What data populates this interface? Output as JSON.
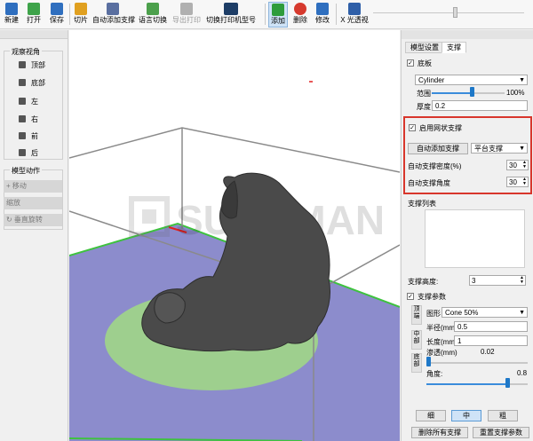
{
  "toolbar": {
    "buttons": [
      {
        "label": "新建",
        "icon": "new-file-icon",
        "color": "#2f6fbf"
      },
      {
        "label": "打开",
        "icon": "open-icon",
        "color": "#3ea34a"
      },
      {
        "label": "保存",
        "icon": "save-icon",
        "color": "#2f6fbf"
      },
      {
        "label": "切片",
        "icon": "slice-icon",
        "color": "#e0a020"
      },
      {
        "label": "自动添加支撑",
        "icon": "auto-support-icon",
        "color": "#5a6fa0"
      },
      {
        "label": "语言切换",
        "icon": "language-icon",
        "color": "#4ca04c"
      },
      {
        "label": "导出打印",
        "icon": "export-print-icon",
        "color": "#b0b0b0"
      },
      {
        "label": "切换打印机型号",
        "icon": "printer-model-icon",
        "color": "#1d3d66"
      },
      {
        "label": "添加",
        "icon": "add-icon",
        "color": "#2e9c3c"
      },
      {
        "label": "删除",
        "icon": "delete-icon",
        "color": "#d63a2e"
      },
      {
        "label": "修改",
        "icon": "edit-icon",
        "color": "#2f6fbf"
      },
      {
        "label": "X 光透视",
        "icon": "xray-icon",
        "color": "#2f5fa8"
      }
    ]
  },
  "left_panel": {
    "view_group_title": "观察视角",
    "views": [
      "顶部",
      "底部",
      "左",
      "右",
      "前",
      "后"
    ],
    "action_group_title": "模型动作",
    "actions": [
      "+ 移动",
      "缩放",
      "↻ 垂直旋转"
    ]
  },
  "viewport": {
    "watermark": "SUNDMAN"
  },
  "right_panel": {
    "tabs": [
      "模型设置",
      "支撑"
    ],
    "base": {
      "label": "底板",
      "checked": true,
      "shape": "Cylinder",
      "range_label": "范围",
      "range_value": "100%",
      "range_fraction": 0.55,
      "thickness_label": "厚度",
      "thickness_value": "0.2"
    },
    "mesh_support": {
      "label": "启用网状支撑",
      "checked": true,
      "auto_add_button": "自动添加支撑",
      "platform_select": "平台支撑",
      "density_label": "自动支撑密度(%)",
      "density_value": "30",
      "angle_label": "自动支撑角度",
      "angle_value": "30"
    },
    "support_list": {
      "label": "支撑列表",
      "height_label": "支撑高度:",
      "height_value": "3"
    },
    "support_params": {
      "label": "支撑参数",
      "checked": true,
      "vtabs": [
        "顶端",
        "中部",
        "底部"
      ],
      "shape_label": "图形",
      "shape_value": "Cone 50%",
      "radius_label": "半径(mm)",
      "radius_value": "0.5",
      "length_label": "长度(mm)",
      "length_value": "1",
      "penetration_label": "渗透(mm)",
      "penetration_value": "0.02",
      "penetration_fraction": 0.0,
      "angle_label": "角度:",
      "angle_value": "0.8",
      "angle_fraction": 0.8
    },
    "size_buttons": [
      "细",
      "中",
      "粗"
    ],
    "size_selected": "中",
    "delete_all_button": "删除所有支撑",
    "reset_button": "重置支撑参数"
  },
  "colors": {
    "accent": "#3b8cdb",
    "highlight_border": "#d8362c",
    "platform": "#8c8ccc",
    "platform_edge": "#3ec23e",
    "base_disc": "#9ecf8e",
    "model": "#4a4a4a"
  }
}
